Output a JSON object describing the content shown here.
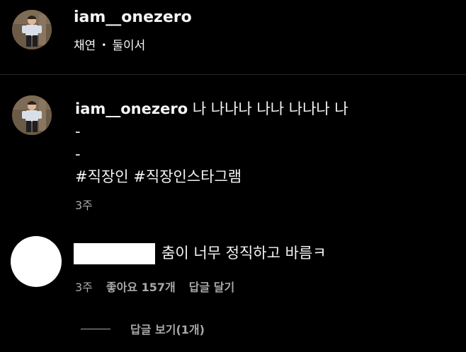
{
  "post_header": {
    "username": "iam__onezero",
    "subtitle_primary": "채연",
    "subtitle_separator": "•",
    "subtitle_secondary": "둘이서"
  },
  "caption": {
    "username": "iam__onezero",
    "text_line1": "나 나나나 나나 나나나 나",
    "line2": "-",
    "line3": "-",
    "hashtag1": "#직장인",
    "hashtag2": "#직장인스타그램",
    "time": "3주"
  },
  "comment": {
    "text": "춤이 너무 정직하고 바름ㅋ",
    "time": "3주",
    "likes": "좋아요 157개",
    "reply_label": "답글 달기",
    "view_replies": "답글 보기(1개)"
  },
  "colors": {
    "background": "#000000",
    "primary_text": "#f5f5f5",
    "secondary_text": "#a8a8a8",
    "divider": "#262626"
  }
}
